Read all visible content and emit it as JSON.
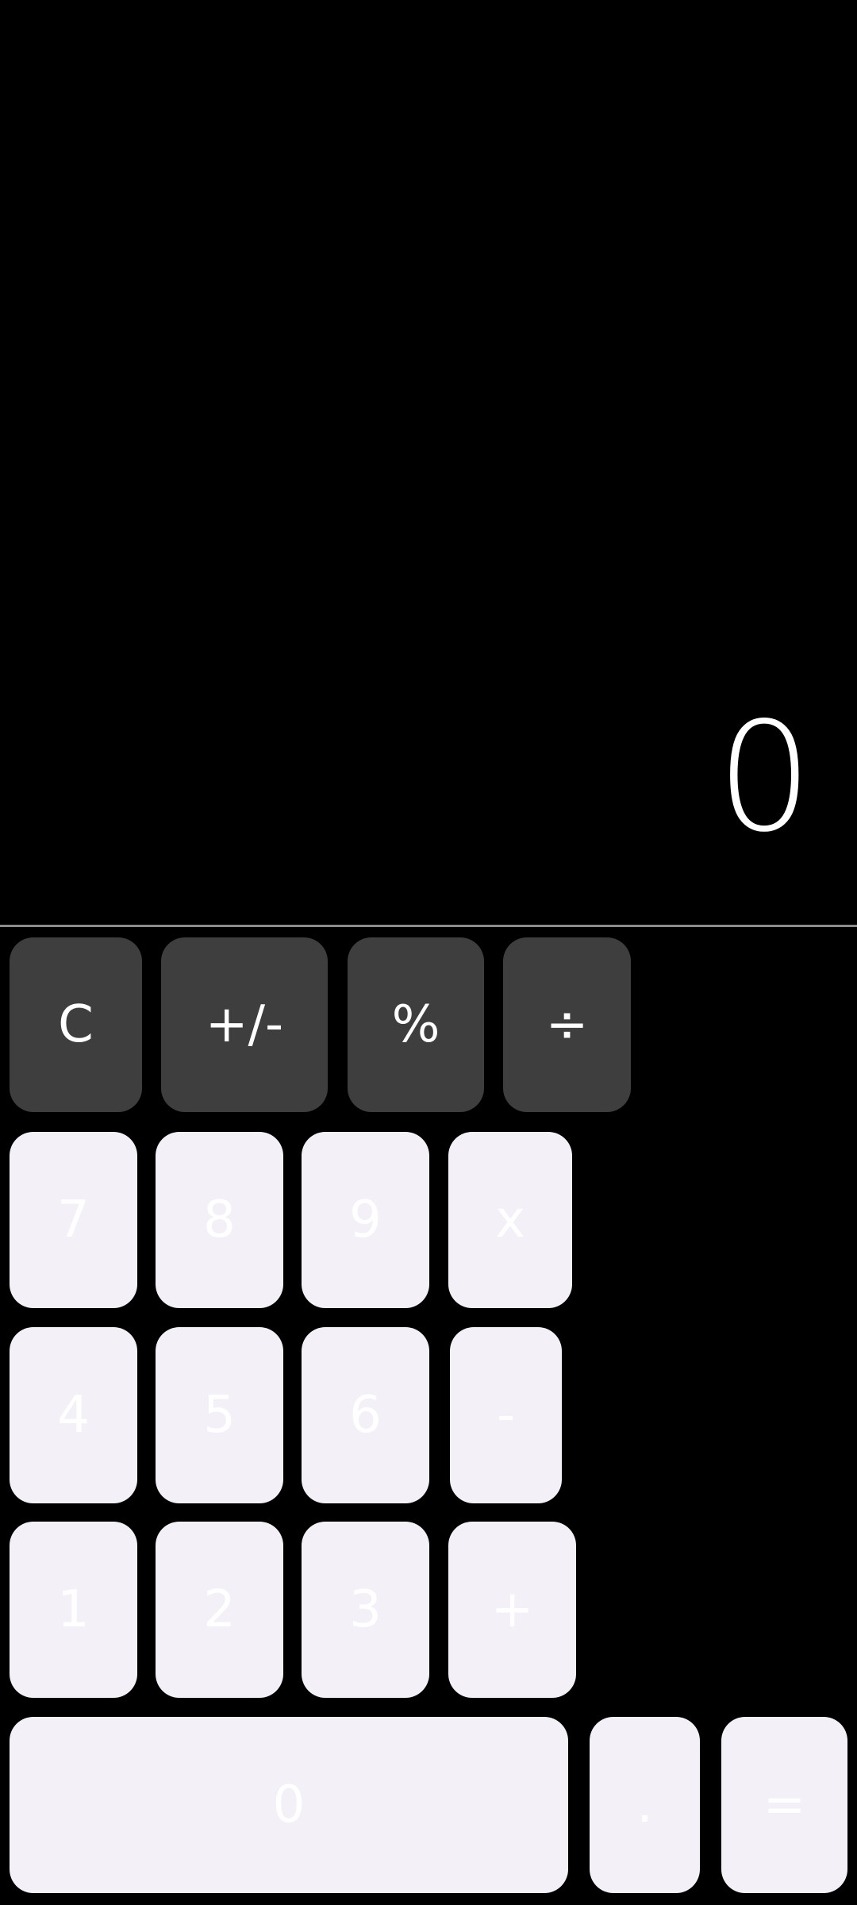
{
  "display": {
    "value": "0"
  },
  "keys": {
    "clear": "C",
    "sign": "+/-",
    "percent": "%",
    "divide": "÷",
    "seven": "7",
    "eight": "8",
    "nine": "9",
    "multiply": "x",
    "four": "4",
    "five": "5",
    "six": "6",
    "subtract": "-",
    "one": "1",
    "two": "2",
    "three": "3",
    "add": "+",
    "zero": "0",
    "decimal": ".",
    "equals": "="
  },
  "colors": {
    "background": "#000000",
    "function_key": "#3e3e3e",
    "number_key": "#f4f0f7",
    "divider": "#8c8c8c",
    "text": "#ffffff"
  }
}
